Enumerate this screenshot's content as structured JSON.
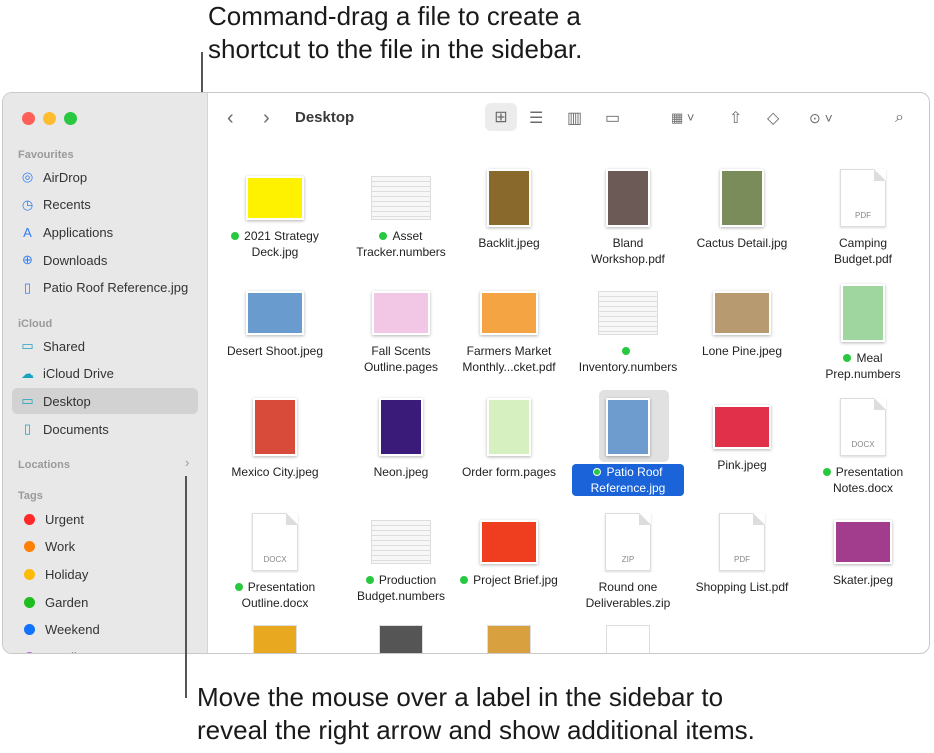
{
  "callouts": {
    "top": "Command-drag a file to create a\nshortcut to the file in the sidebar.",
    "bottom": "Move the mouse over a label in the sidebar to\nreveal the right arrow and show additional items."
  },
  "sidebar": {
    "favourites_label": "Favourites",
    "favourites": [
      {
        "label": "AirDrop",
        "icon": "airdrop-icon",
        "glyph": "◎"
      },
      {
        "label": "Recents",
        "icon": "clock-icon",
        "glyph": "◷"
      },
      {
        "label": "Applications",
        "icon": "applications-icon",
        "glyph": "A"
      },
      {
        "label": "Downloads",
        "icon": "download-icon",
        "glyph": "⊕"
      },
      {
        "label": "Patio Roof Reference.jpg",
        "icon": "document-icon",
        "glyph": "▯"
      }
    ],
    "icloud_label": "iCloud",
    "icloud": [
      {
        "label": "Shared",
        "icon": "shared-folder-icon",
        "glyph": "▭"
      },
      {
        "label": "iCloud Drive",
        "icon": "cloud-icon",
        "glyph": "☁"
      },
      {
        "label": "Desktop",
        "icon": "desktop-icon",
        "glyph": "▭",
        "selected": true
      },
      {
        "label": "Documents",
        "icon": "document-icon",
        "glyph": "▯"
      }
    ],
    "locations_label": "Locations",
    "tags_label": "Tags",
    "tags": [
      {
        "label": "Urgent",
        "color": "#fe2a2a"
      },
      {
        "label": "Work",
        "color": "#ff8005"
      },
      {
        "label": "Holiday",
        "color": "#fdbb05"
      },
      {
        "label": "Garden",
        "color": "#1fbd1f"
      },
      {
        "label": "Weekend",
        "color": "#1172fe"
      },
      {
        "label": "Family",
        "color": "#bb5fe0"
      }
    ]
  },
  "toolbar": {
    "title": "Desktop",
    "view": "icon"
  },
  "colors": {
    "accent": "#1a63d9",
    "tag_green": "#28c840",
    "sidebar_bg": "#e9e8e8"
  },
  "files": [
    {
      "name": "2021 Strategy Deck.jpg",
      "tag": true,
      "kind": "img",
      "color": "#fff200"
    },
    {
      "name": "Asset Tracker.numbers",
      "tag": true,
      "kind": "sheet",
      "color": "#f4f4f4"
    },
    {
      "name": "Backlit.jpeg",
      "kind": "img",
      "color": "#8a6a2c",
      "tall": true
    },
    {
      "name": "Bland Workshop.pdf",
      "kind": "img",
      "color": "#6b5a55",
      "tall": true
    },
    {
      "name": "Cactus Detail.jpg",
      "kind": "img",
      "color": "#7a8c5a",
      "tall": true
    },
    {
      "name": "Camping Budget.pdf",
      "kind": "doc",
      "ext": "PDF"
    },
    {
      "name": "Desert Shoot.jpeg",
      "kind": "img",
      "color": "#6a9bcf"
    },
    {
      "name": "Fall Scents Outline.pages",
      "kind": "img",
      "color": "#f2c7e6"
    },
    {
      "name": "Farmers Market Monthly...cket.pdf",
      "kind": "img",
      "color": "#f5a443"
    },
    {
      "name": "Inventory.numbers",
      "tag": true,
      "kind": "sheet",
      "color": "#f4f4f4"
    },
    {
      "name": "Lone Pine.jpeg",
      "kind": "img",
      "color": "#b89a70"
    },
    {
      "name": "Meal Prep.numbers",
      "tag": true,
      "kind": "img",
      "color": "#9fd6a0",
      "tall": true
    },
    {
      "name": "Mexico City.jpeg",
      "kind": "img",
      "color": "#d84a3a",
      "tall": true
    },
    {
      "name": "Neon.jpeg",
      "kind": "img",
      "color": "#3b1b7a",
      "tall": true
    },
    {
      "name": "Order form.pages",
      "kind": "img",
      "color": "#d6f0c0",
      "tall": true
    },
    {
      "name": "Patio Roof Reference.jpg",
      "tag": true,
      "kind": "img",
      "color": "#6e9ccf",
      "tall": true,
      "selected": true
    },
    {
      "name": "Pink.jpeg",
      "kind": "img",
      "color": "#e0304a"
    },
    {
      "name": "Presentation Notes.docx",
      "tag": true,
      "kind": "doc",
      "ext": "DOCX"
    },
    {
      "name": "Presentation Outline.docx",
      "tag": true,
      "kind": "doc",
      "ext": "DOCX"
    },
    {
      "name": "Production Budget.numbers",
      "tag": true,
      "kind": "sheet",
      "color": "#f4f4f4"
    },
    {
      "name": "Project Brief.jpg",
      "tag": true,
      "kind": "img",
      "color": "#ee3d1f"
    },
    {
      "name": "Round one Deliverables.zip",
      "kind": "doc",
      "ext": "ZIP"
    },
    {
      "name": "Shopping List.pdf",
      "kind": "doc",
      "ext": "PDF"
    },
    {
      "name": "Skater.jpeg",
      "kind": "img",
      "color": "#a23c8c"
    }
  ],
  "partial_row": [
    {
      "color": "#e8a820"
    },
    {
      "color": "#555555"
    },
    {
      "color": "#d9a040"
    },
    {
      "color": "#ffffff"
    }
  ]
}
